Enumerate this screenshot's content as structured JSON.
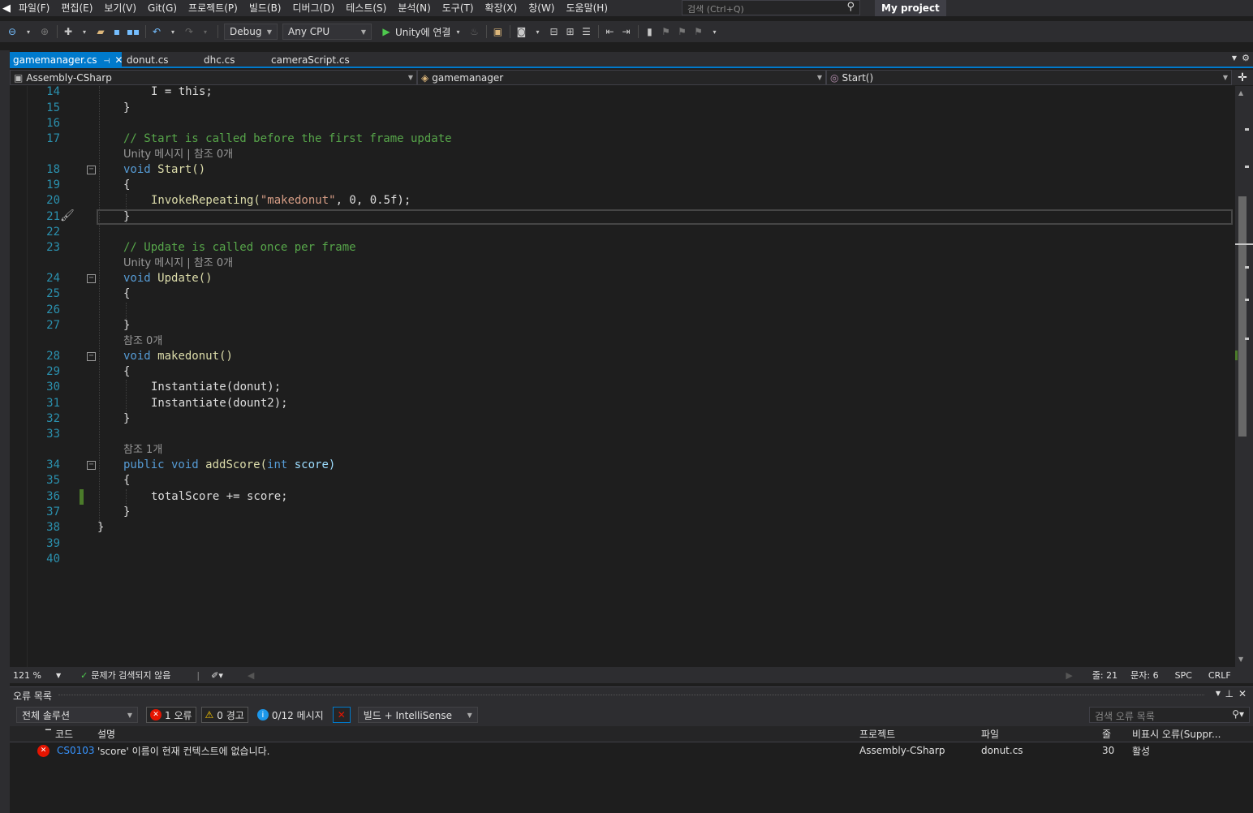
{
  "menu": {
    "items": [
      "파일(F)",
      "편집(E)",
      "보기(V)",
      "Git(G)",
      "프로젝트(P)",
      "빌드(B)",
      "디버그(D)",
      "테스트(S)",
      "분석(N)",
      "도구(T)",
      "확장(X)",
      "창(W)",
      "도움말(H)"
    ],
    "search_placeholder": "검색 (Ctrl+Q)",
    "project_title": "My project"
  },
  "toolbar": {
    "config": "Debug",
    "platform": "Any CPU",
    "run_label": "Unity에 연결"
  },
  "tabs": {
    "active": "gamemanager.cs",
    "others": [
      "donut.cs",
      "dhc.cs",
      "cameraScript.cs"
    ]
  },
  "nav": {
    "project": "Assembly-CSharp",
    "class": "gamemanager",
    "member": "Start()"
  },
  "code": {
    "l14": "I = this;",
    "l15": "}",
    "l17": "// Start is called before the first frame update",
    "lens1": "Unity 메시지 | 참조 0개",
    "l18_kw": "void",
    "l18_fn": "Start()",
    "l19": "{",
    "l20_fn": "InvokeRepeating(",
    "l20_str": "\"makedonut\"",
    "l20_rest": ", 0, 0.5f);",
    "l21": "}",
    "l23": "// Update is called once per frame",
    "lens2": "Unity 메시지 | 참조 0개",
    "l24_kw": "void",
    "l24_fn": "Update()",
    "l25": "{",
    "l27": "}",
    "lens3": "참조 0개",
    "l28_kw": "void",
    "l28_fn": "makedonut()",
    "l29": "{",
    "l30": "Instantiate(donut);",
    "l31": "Instantiate(dount2);",
    "l32": "}",
    "lens4": "참조 1개",
    "l34_kw": "public void",
    "l34_fn": "addScore(",
    "l34_kw2": "int",
    "l34_var": "score)",
    "l35": "{",
    "l36": "totalScore += score;",
    "l37": "}",
    "l38": "}"
  },
  "line_numbers": [
    "14",
    "15",
    "16",
    "17",
    "18",
    "19",
    "20",
    "21",
    "22",
    "23",
    "24",
    "25",
    "26",
    "27",
    "28",
    "29",
    "30",
    "31",
    "32",
    "33",
    "34",
    "35",
    "36",
    "37",
    "38",
    "39",
    "40"
  ],
  "status": {
    "zoom": "121 %",
    "issues": "문제가 검색되지 않음",
    "line": "줄: 21",
    "char": "문자: 6",
    "spc": "SPC",
    "crlf": "CRLF"
  },
  "errors": {
    "title": "오류 목록",
    "scope": "전체 솔루션",
    "errors_btn": "1 오류",
    "warnings_btn": "0 경고",
    "messages_btn": "0/12 메시지",
    "build_filter": "빌드 + IntelliSense",
    "search_placeholder": "검색 오류 목록",
    "headers": {
      "code": "코드",
      "desc": "설명",
      "project": "프로젝트",
      "file": "파일",
      "line": "줄",
      "suppress": "비표시 오류(Suppr..."
    },
    "rows": [
      {
        "code": "CS0103",
        "desc": "'score' 이름이 현재 컨텍스트에 없습니다.",
        "project": "Assembly-CSharp",
        "file": "donut.cs",
        "line": "30",
        "state": "활성"
      }
    ]
  }
}
